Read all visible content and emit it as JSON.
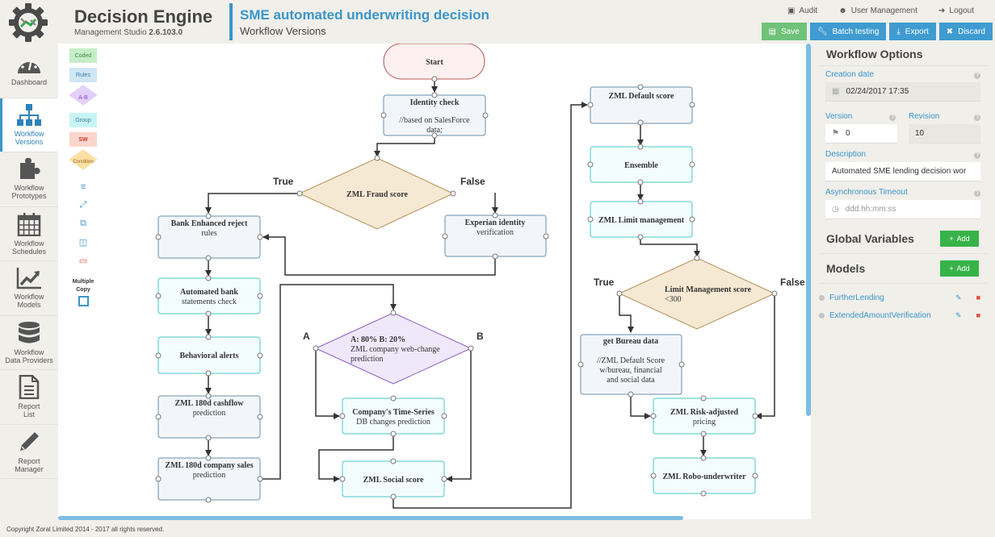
{
  "app": {
    "name": "Decision Engine",
    "subtitle_prefix": "Management Studio",
    "version": "2.6.103.0"
  },
  "header": {
    "title": "SME automated underwriting decision",
    "subtitle": "Workflow Versions",
    "links": [
      {
        "icon": "briefcase-icon",
        "label": "Audit"
      },
      {
        "icon": "users-icon",
        "label": "User Management"
      },
      {
        "icon": "logout-icon",
        "label": "Logout"
      }
    ],
    "actions": [
      {
        "icon": "save-icon",
        "label": "Save",
        "color": "#6fc27a"
      },
      {
        "icon": "wrench-icon",
        "label": "Batch testing",
        "color": "#3f9bd0"
      },
      {
        "icon": "download-icon",
        "label": "Export",
        "color": "#3f9bd0"
      },
      {
        "icon": "close-icon",
        "label": "Discard",
        "color": "#3f9bd0"
      }
    ]
  },
  "sidebar": {
    "items": [
      {
        "label1": "Dashboard",
        "label2": "",
        "icon": "dashboard-icon",
        "active": false
      },
      {
        "label1": "Workflow",
        "label2": "Versions",
        "icon": "hierarchy-icon",
        "active": true
      },
      {
        "label1": "Workflow",
        "label2": "Prototypes",
        "icon": "puzzle-icon",
        "active": false
      },
      {
        "label1": "Workflow",
        "label2": "Schedules",
        "icon": "calendar-icon",
        "active": false
      },
      {
        "label1": "Workflow",
        "label2": "Models",
        "icon": "chart-line-icon",
        "active": false
      },
      {
        "label1": "Workflow",
        "label2": "Data Providers",
        "icon": "database-icon",
        "active": false
      },
      {
        "label1": "Report",
        "label2": "List",
        "icon": "document-icon",
        "active": false
      },
      {
        "label1": "Report",
        "label2": "Manager",
        "icon": "pencil-icon",
        "active": false
      }
    ]
  },
  "palette": {
    "items": [
      "Coded",
      "Rules",
      "A-B",
      "Group",
      "SW",
      "Condition"
    ],
    "tools": [
      "align-icon",
      "expand-icon",
      "copy-icon",
      "paste-icon",
      "delete-icon"
    ],
    "multiple_copy_line1": "Multiple",
    "multiple_copy_line2": "Copy"
  },
  "flow": {
    "branch_labels": {
      "fraud_true": "True",
      "fraud_false": "False",
      "ab_a": "A",
      "ab_b": "B",
      "limit_true": "True",
      "limit_false": "False"
    },
    "nodes": {
      "start": {
        "title": "Start"
      },
      "identity": {
        "title": "Identity check",
        "lines": [
          "//based on SalesForce",
          "data;"
        ]
      },
      "fraud": {
        "title": "ZML Fraud score"
      },
      "bank": {
        "title": "Bank Enhanced reject",
        "lines": [
          "rules"
        ]
      },
      "experian": {
        "title": "Experian identity",
        "lines": [
          "verification"
        ]
      },
      "automated": {
        "title": "Automated bank",
        "lines": [
          "statements check"
        ]
      },
      "behavioral": {
        "title": "Behavioral alerts"
      },
      "cashflow": {
        "title": "ZML 180d cashflow",
        "lines": [
          "prediction"
        ]
      },
      "sales": {
        "title": "ZML 180d company sales",
        "lines": [
          "prediction"
        ]
      },
      "ab": {
        "title": "A: 80% B: 20%",
        "lines": [
          "ZML company web-change",
          "prediction"
        ]
      },
      "timeseries": {
        "title": "Company's Time-Series",
        "lines": [
          "DB changes prediction"
        ]
      },
      "social": {
        "title": "ZML Social score"
      },
      "default": {
        "title": "ZML Default score"
      },
      "ensemble": {
        "title": "Ensemble"
      },
      "limit": {
        "title": "ZML Limit management"
      },
      "limitscore": {
        "title": "Limit Management score",
        "lines": [
          "<300"
        ]
      },
      "bureau": {
        "title": "get Bureau data",
        "lines": [
          "//ZML Default Score",
          "w/bureau, financial",
          "and social data"
        ]
      },
      "risk": {
        "title": "ZML Risk-adjusted",
        "lines": [
          "pricing"
        ]
      },
      "robo": {
        "title": "ZML Robo-underwriter"
      }
    }
  },
  "options": {
    "title": "Workflow Options",
    "creation_date_label": "Creation date",
    "creation_date": "02/24/2017 17:35",
    "version_label": "Version",
    "version": "0",
    "revision_label": "Revision",
    "revision": "10",
    "description_label": "Description",
    "description": "Automated SME lending decision wor",
    "timeout_label": "Asynchronous Timeout",
    "timeout_placeholder": "ddd.hh:mm:ss",
    "global_variables_title": "Global Variables",
    "models_title": "Models",
    "add_label": "Add",
    "models": [
      "FurtherLending",
      "ExtendedAmountVerification"
    ]
  },
  "footer": {
    "copyright": "Copyright Zoral Limited 2014 - 2017 all rights reserved."
  }
}
